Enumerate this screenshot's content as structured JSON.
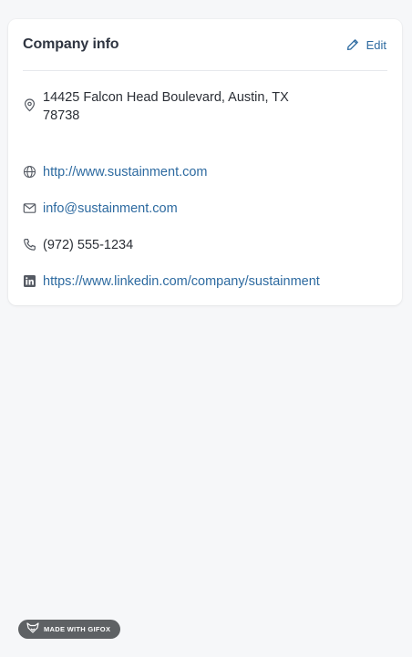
{
  "card": {
    "title": "Company info",
    "edit_label": "Edit"
  },
  "info": {
    "address_line1": "14425 Falcon Head Boulevard, Austin, TX",
    "address_line2": "78738",
    "website": "http://www.sustainment.com",
    "email": "info@sustainment.com",
    "phone": "(972) 555-1234",
    "linkedin": "https://www.linkedin.com/company/sustainment"
  },
  "badge": {
    "label": "MADE WITH GIFOX"
  },
  "icons": {
    "address": "map-pin-icon",
    "website": "globe-icon",
    "email": "mail-icon",
    "phone": "phone-icon",
    "linkedin": "linkedin-icon",
    "edit": "pencil-icon"
  },
  "colors": {
    "link": "#2d6aa0",
    "text": "#2b2f36",
    "background": "#f6f7f9",
    "card": "#ffffff"
  }
}
